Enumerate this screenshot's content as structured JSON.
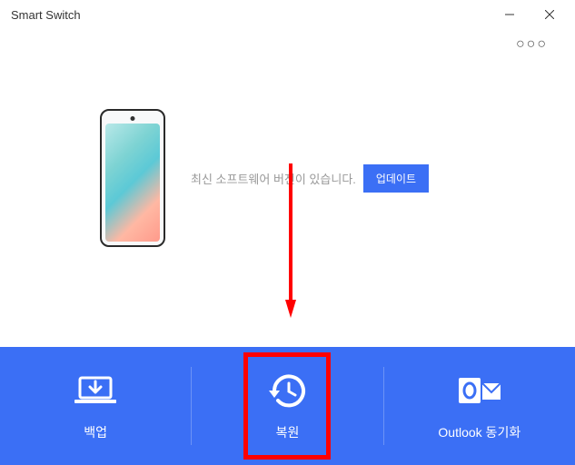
{
  "titlebar": {
    "title": "Smart Switch"
  },
  "content": {
    "status_text": "최신 소프트웨어 버전이 있습니다.",
    "update_button": "업데이트"
  },
  "actions": {
    "backup": "백업",
    "restore": "복원",
    "outlook_sync": "Outlook 동기화"
  }
}
